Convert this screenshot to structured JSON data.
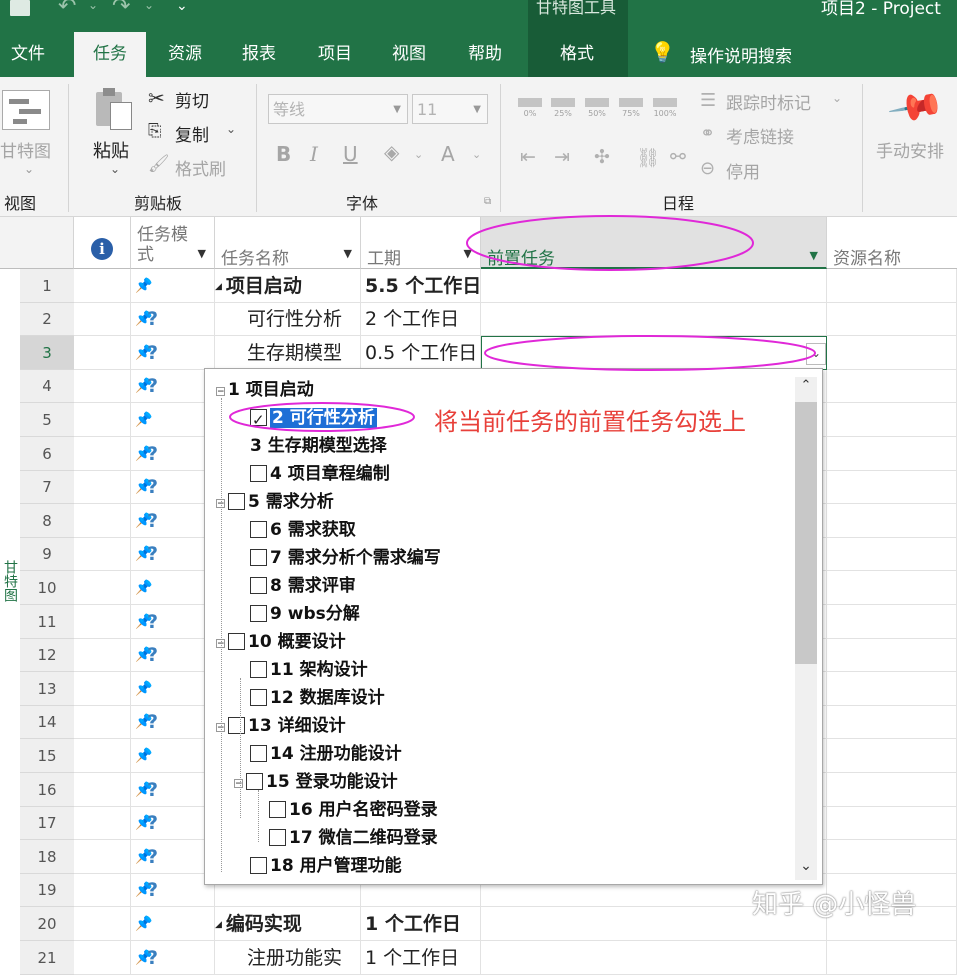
{
  "titlebar": {
    "context_tab_group": "甘特图工具",
    "window_title": "项目2  -  Project"
  },
  "tabs": [
    {
      "label": "文件"
    },
    {
      "label": "任务"
    },
    {
      "label": "资源"
    },
    {
      "label": "报表"
    },
    {
      "label": "项目"
    },
    {
      "label": "视图"
    },
    {
      "label": "帮助"
    },
    {
      "label": "格式"
    }
  ],
  "tell_me": "操作说明搜索",
  "ribbon": {
    "view_group": {
      "gantt_label": "甘特图",
      "group_label": "视图"
    },
    "clipboard": {
      "paste": "粘贴",
      "cut": "剪切",
      "copy": "复制",
      "format_painter": "格式刷",
      "group_label": "剪贴板"
    },
    "font": {
      "font_name": "等线",
      "font_size": "11",
      "bold": "B",
      "italic": "I",
      "underline": "U",
      "font_color": "A",
      "group_label": "字体"
    },
    "schedule": {
      "percents": [
        "0%",
        "25%",
        "50%",
        "75%",
        "100%"
      ],
      "mark_on_track": "跟踪时标记",
      "respect_links": "考虑链接",
      "inactivate": "停用",
      "group_label": "日程"
    },
    "tasks": {
      "manual_schedule": "手动安排"
    }
  },
  "columns": {
    "info": "i",
    "task_mode": "任务模式",
    "task_name": "任务名称",
    "duration": "工期",
    "predecessors": "前置任务",
    "resource_names": "资源名称"
  },
  "side_label": "甘特图",
  "rows": [
    {
      "num": "1",
      "name": "项目启动",
      "duration": "5.5 个工作日"
    },
    {
      "num": "2",
      "name": "可行性分析",
      "duration": "2 个工作日"
    },
    {
      "num": "3",
      "name": "生存期模型",
      "duration": "0.5 个工作日"
    },
    {
      "num": "4"
    },
    {
      "num": "5"
    },
    {
      "num": "6"
    },
    {
      "num": "7"
    },
    {
      "num": "8"
    },
    {
      "num": "9"
    },
    {
      "num": "10"
    },
    {
      "num": "11"
    },
    {
      "num": "12"
    },
    {
      "num": "13"
    },
    {
      "num": "14"
    },
    {
      "num": "15"
    },
    {
      "num": "16"
    },
    {
      "num": "17"
    },
    {
      "num": "18"
    },
    {
      "num": "19"
    },
    {
      "num": "20",
      "name": "编码实现",
      "duration": "1 个工作日"
    },
    {
      "num": "21",
      "name": "注册功能实",
      "duration": "1 个工作日"
    }
  ],
  "dropdown_tree": [
    {
      "label": "1  项目启动"
    },
    {
      "label": "2  可行性分析"
    },
    {
      "label": "3  生存期模型选择"
    },
    {
      "label": "4  项目章程编制"
    },
    {
      "label": "5  需求分析"
    },
    {
      "label": "6  需求获取"
    },
    {
      "label": "7  需求分析个需求编写"
    },
    {
      "label": "8  需求评审"
    },
    {
      "label": "9  wbs分解"
    },
    {
      "label": "10  概要设计"
    },
    {
      "label": "11  架构设计"
    },
    {
      "label": "12  数据库设计"
    },
    {
      "label": "13  详细设计"
    },
    {
      "label": "14  注册功能设计"
    },
    {
      "label": "15  登录功能设计"
    },
    {
      "label": "16  用户名密码登录"
    },
    {
      "label": "17  微信二维码登录"
    },
    {
      "label": "18  用户管理功能"
    }
  ],
  "annotation": "将当前任务的前置任务勾选上",
  "watermark": "知乎 @小怪兽",
  "colors": {
    "brand": "#217346",
    "annotation": "#e8403a",
    "highlight_ellipse": "#e028d8",
    "selection": "#1e6fd6"
  }
}
